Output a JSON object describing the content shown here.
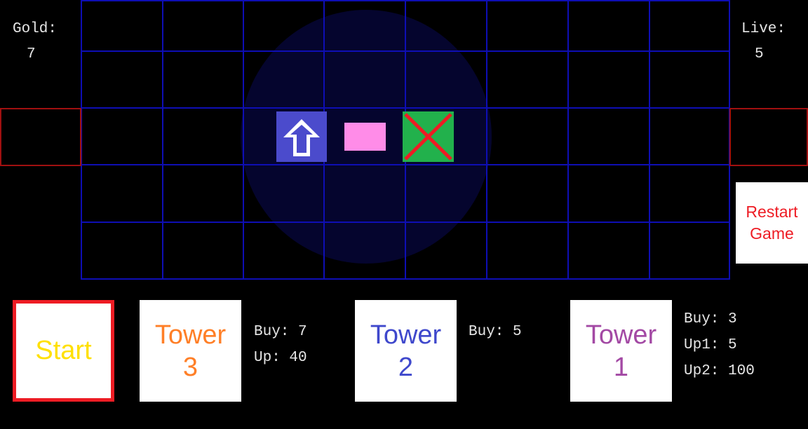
{
  "hud": {
    "gold_label": "Gold:",
    "gold_value": "7",
    "lives_label": "Live:",
    "lives_value": "5"
  },
  "map": {
    "columns": 8,
    "rows": 5,
    "grid_color": "#0e0eb4",
    "portal_color": "#a01010",
    "range_color": "#05052e"
  },
  "sprites": {
    "upgrade_tower": {
      "icon": "arrow-up-icon",
      "color": "#4b4bcc"
    },
    "enemy": {
      "icon": "enemy-block",
      "color": "#ff8ce8"
    },
    "cross_tower": {
      "icon": "red-x-icon",
      "color": "#22b14c"
    }
  },
  "buttons": {
    "restart_line1": "Restart",
    "restart_line2": "Game",
    "start": "Start"
  },
  "shop": {
    "tower3": {
      "title": "Tower",
      "number": "3",
      "prices": [
        "Buy: 7",
        "Up: 40"
      ],
      "color": "#ff7f27"
    },
    "tower2": {
      "title": "Tower",
      "number": "2",
      "prices": [
        "Buy: 5"
      ],
      "color": "#3f48cc"
    },
    "tower1": {
      "title": "Tower",
      "number": "1",
      "prices": [
        "Buy: 3",
        "Up1: 5",
        "Up2: 100"
      ],
      "color": "#a349a4"
    }
  }
}
